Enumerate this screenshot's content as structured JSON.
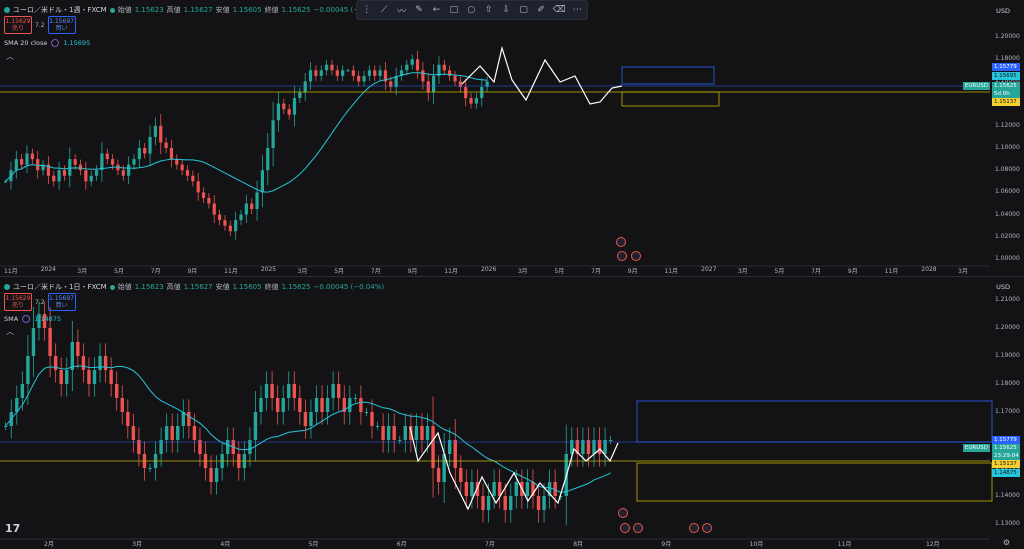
{
  "colors": {
    "up": "#26a69a",
    "down": "#ef5350",
    "sma": "#26c6da",
    "pattern": "#ffffff",
    "blueBox": "#2962ff",
    "yellowBox": "#c8b400",
    "bg": "#131316"
  },
  "top": {
    "title": "ユーロ／米ドル・1週・FXCM",
    "legend": {
      "open_k": "始値",
      "open": "1.15623",
      "high_k": "高値",
      "high": "1.15627",
      "low_k": "安値",
      "low": "1.15605",
      "close_k": "終値",
      "close": "1.15625",
      "change": "−0.00045 (−0.04%)"
    },
    "sell_price": "1.15629",
    "sell_label": "売り",
    "spread": "7.2",
    "buy_price": "1.15697",
    "buy_label": "買い",
    "sma_label": "SMA 20 close",
    "sma_value": "1.15695",
    "currency": "USD",
    "yticks": [
      "1.20000",
      "1.18000",
      "1.16000",
      "1.14000",
      "1.12000",
      "1.10000",
      "1.08000",
      "1.06000",
      "1.04000",
      "1.02000",
      "1.00000"
    ],
    "xticks": [
      "11月",
      "2024",
      "3月",
      "5月",
      "7月",
      "9月",
      "11月",
      "2025",
      "3月",
      "5月",
      "7月",
      "9月",
      "11月",
      "2026",
      "3月",
      "5月",
      "7月",
      "9月",
      "11月",
      "2027",
      "3月",
      "5月",
      "7月",
      "9月",
      "11月",
      "2028",
      "3月"
    ],
    "tags": {
      "t1": "1.15779",
      "t2": "1.15695",
      "sym": "EURUSD",
      "price": "1.15625",
      "timer": "5d 0h",
      "t3": "1.15137"
    }
  },
  "bottom": {
    "title": "ユーロ／米ドル・1日・FXCM",
    "legend": {
      "open_k": "始値",
      "open": "1.15623",
      "high_k": "高値",
      "high": "1.15627",
      "low_k": "安値",
      "low": "1.15605",
      "close_k": "終値",
      "close": "1.15625",
      "change": "−0.00045 (−0.04%)"
    },
    "sell_price": "1.15629",
    "sell_label": "売り",
    "spread": "7.2",
    "buy_price": "1.15697",
    "buy_label": "買い",
    "sma_label": "SMA",
    "sma_value": "1.14875",
    "currency": "USD",
    "yticks": [
      "1.21000",
      "1.20000",
      "1.19000",
      "1.18000",
      "1.17000",
      "1.16000",
      "1.15000",
      "1.14000",
      "1.13000"
    ],
    "xticks": [
      "2月",
      "3月",
      "4月",
      "5月",
      "6月",
      "7月",
      "8月",
      "9月",
      "10月",
      "11月",
      "12月"
    ],
    "tags": {
      "t1": "1.15779",
      "sym": "EURUSD",
      "price": "1.15625",
      "timer": "23:29:04",
      "t3": "1.15137",
      "t4": "1.14875"
    }
  }
}
